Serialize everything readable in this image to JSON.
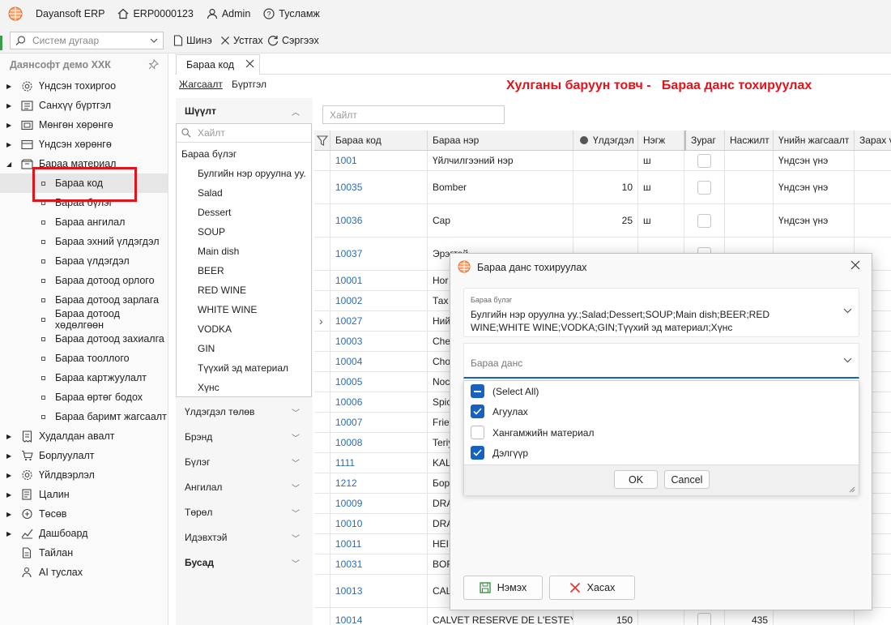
{
  "topbar": {
    "app_name": "Dayansoft ERP",
    "db": "ERP0000123",
    "user": "Admin",
    "help": "Тусламж"
  },
  "toolbar": {
    "search_placeholder": "Систем дугаар",
    "new": "Шинэ",
    "delete": "Устгах",
    "refresh": "Сэргээх"
  },
  "sidebar": {
    "company": "Даянсофт демо ХХК",
    "groups": [
      "Үндсэн тохиргоо",
      "Санхүү бүртгэл",
      "Мөнгөн хөрөнгө",
      "Үндсэн хөрөнгө",
      "Бараа материал"
    ],
    "sub_items": [
      "Бараа код",
      "Бараа бүлэг",
      "Бараа ангилал",
      "Бараа эхний үлдэгдэл",
      "Бараа үлдэгдэл",
      "Бараа дотоод орлого",
      "Бараа дотоод зарлага",
      "Бараа дотоод хөдөлгөөн",
      "Бараа дотоод захиалга",
      "Бараа тооллого",
      "Бараа картжуулалт",
      "Бараа өртөг бодох",
      "Бараа баримт жагсаалт"
    ],
    "groups2": [
      "Худалдан авалт",
      "Борлуулалт",
      "Үйлдвэрлэл",
      "Цалин",
      "Төсөв",
      "Дашбоард",
      "Тайлан",
      "AI туслах"
    ]
  },
  "tab": {
    "label": "Бараа код"
  },
  "subtabs": {
    "list": "Жагсаалт",
    "register": "Бүртгэл"
  },
  "hint": "Хулганы баруун товч -   Бараа данс тохируулах",
  "filter": {
    "title": "Шүүлт",
    "search_placeholder": "Хайлт",
    "group_label": "Бараа бүлэг",
    "items": [
      "Булгийн нэр оруулна уу.",
      "Salad",
      "Dessert",
      "SOUP",
      "Main dish",
      "BEER",
      "RED WINE",
      "WHITE WINE",
      "VODKA",
      "GIN",
      "Түүхий эд материал",
      "Хүнс"
    ],
    "sections": [
      "Үлдэгдэл төлөв",
      "Брэнд",
      "Бүлэг",
      "Ангилал",
      "Төрөл",
      "Идэвхтэй",
      "Бусад"
    ]
  },
  "grid": {
    "search_placeholder": "Хайлт",
    "columns": [
      "Бараа код",
      "Бараа нэр",
      "Үлдэгдэл",
      "Нэгж",
      "Зураг",
      "Насжилт",
      "Үнийн жагсаалт",
      "Зарах ү"
    ],
    "rows": [
      {
        "code": "1001",
        "name": "Үйлчилгээний нэр",
        "qty": "",
        "unit": "ш",
        "age": "",
        "price": "Үндсэн үнэ"
      },
      {
        "code": "10035",
        "name": "Bomber",
        "qty": "10",
        "unit": "ш",
        "age": "",
        "price": "Үндсэн үнэ"
      },
      {
        "code": "10036",
        "name": "Cap",
        "qty": "25",
        "unit": "ш",
        "age": "",
        "price": "Үндсэн үнэ"
      },
      {
        "code": "10037",
        "name": "Эрэгтэй",
        "qty": "",
        "unit": "",
        "age": "",
        "price": ""
      },
      {
        "code": "10001",
        "name": "Hor",
        "qty": "",
        "unit": "",
        "age": "",
        "price": ""
      },
      {
        "code": "10002",
        "name": "Тах",
        "qty": "",
        "unit": "",
        "age": "",
        "price": ""
      },
      {
        "code": "10027",
        "name": "Ний",
        "qty": "",
        "unit": "",
        "age": "",
        "price": ""
      },
      {
        "code": "10003",
        "name": "Che",
        "qty": "",
        "unit": "",
        "age": "",
        "price": ""
      },
      {
        "code": "10004",
        "name": "Cho",
        "qty": "",
        "unit": "",
        "age": "",
        "price": ""
      },
      {
        "code": "10005",
        "name": "Noc",
        "qty": "",
        "unit": "",
        "age": "",
        "price": ""
      },
      {
        "code": "10006",
        "name": "Spic",
        "qty": "",
        "unit": "",
        "age": "",
        "price": ""
      },
      {
        "code": "10007",
        "name": "Fried",
        "qty": "",
        "unit": "",
        "age": "",
        "price": ""
      },
      {
        "code": "10008",
        "name": "Teriy",
        "qty": "",
        "unit": "",
        "age": "",
        "price": ""
      },
      {
        "code": "1111",
        "name": "KALT",
        "qty": "",
        "unit": "",
        "age": "",
        "price": ""
      },
      {
        "code": "1212",
        "name": "Бор",
        "qty": "",
        "unit": "",
        "age": "",
        "price": ""
      },
      {
        "code": "10009",
        "name": "DRA",
        "qty": "",
        "unit": "",
        "age": "",
        "price": ""
      },
      {
        "code": "10010",
        "name": "DRA",
        "qty": "",
        "unit": "",
        "age": "",
        "price": ""
      },
      {
        "code": "10011",
        "name": "HEIN",
        "qty": "",
        "unit": "",
        "age": "",
        "price": ""
      },
      {
        "code": "10031",
        "name": "BOR",
        "qty": "",
        "unit": "",
        "age": "",
        "price": ""
      },
      {
        "code": "10013",
        "name": "CAL BOR",
        "qty": "",
        "unit": "",
        "age": "",
        "price": ""
      },
      {
        "code": "10014",
        "name": "CALVET RESERVE DE L'ESTEY",
        "qty": "150",
        "unit": "",
        "age": "435",
        "price": ""
      }
    ]
  },
  "dialog": {
    "title": "Бараа данс тохируулах",
    "group_label": "Бараа бүлэг",
    "group_value": "Булгийн нэр оруулна уу.;Salad;Dessert;SOUP;Main dish;BEER;RED WINE;WHITE WINE;VODKA;GIN;Түүхий эд материал;Хүнс",
    "account_placeholder": "Бараа данс",
    "options": [
      "(Select All)",
      "Агуулах",
      "Хангамжийн материал",
      "Дэлгүүр"
    ],
    "ok": "OK",
    "cancel": "Cancel",
    "save": "Нэмэх",
    "remove": "Хасах"
  }
}
